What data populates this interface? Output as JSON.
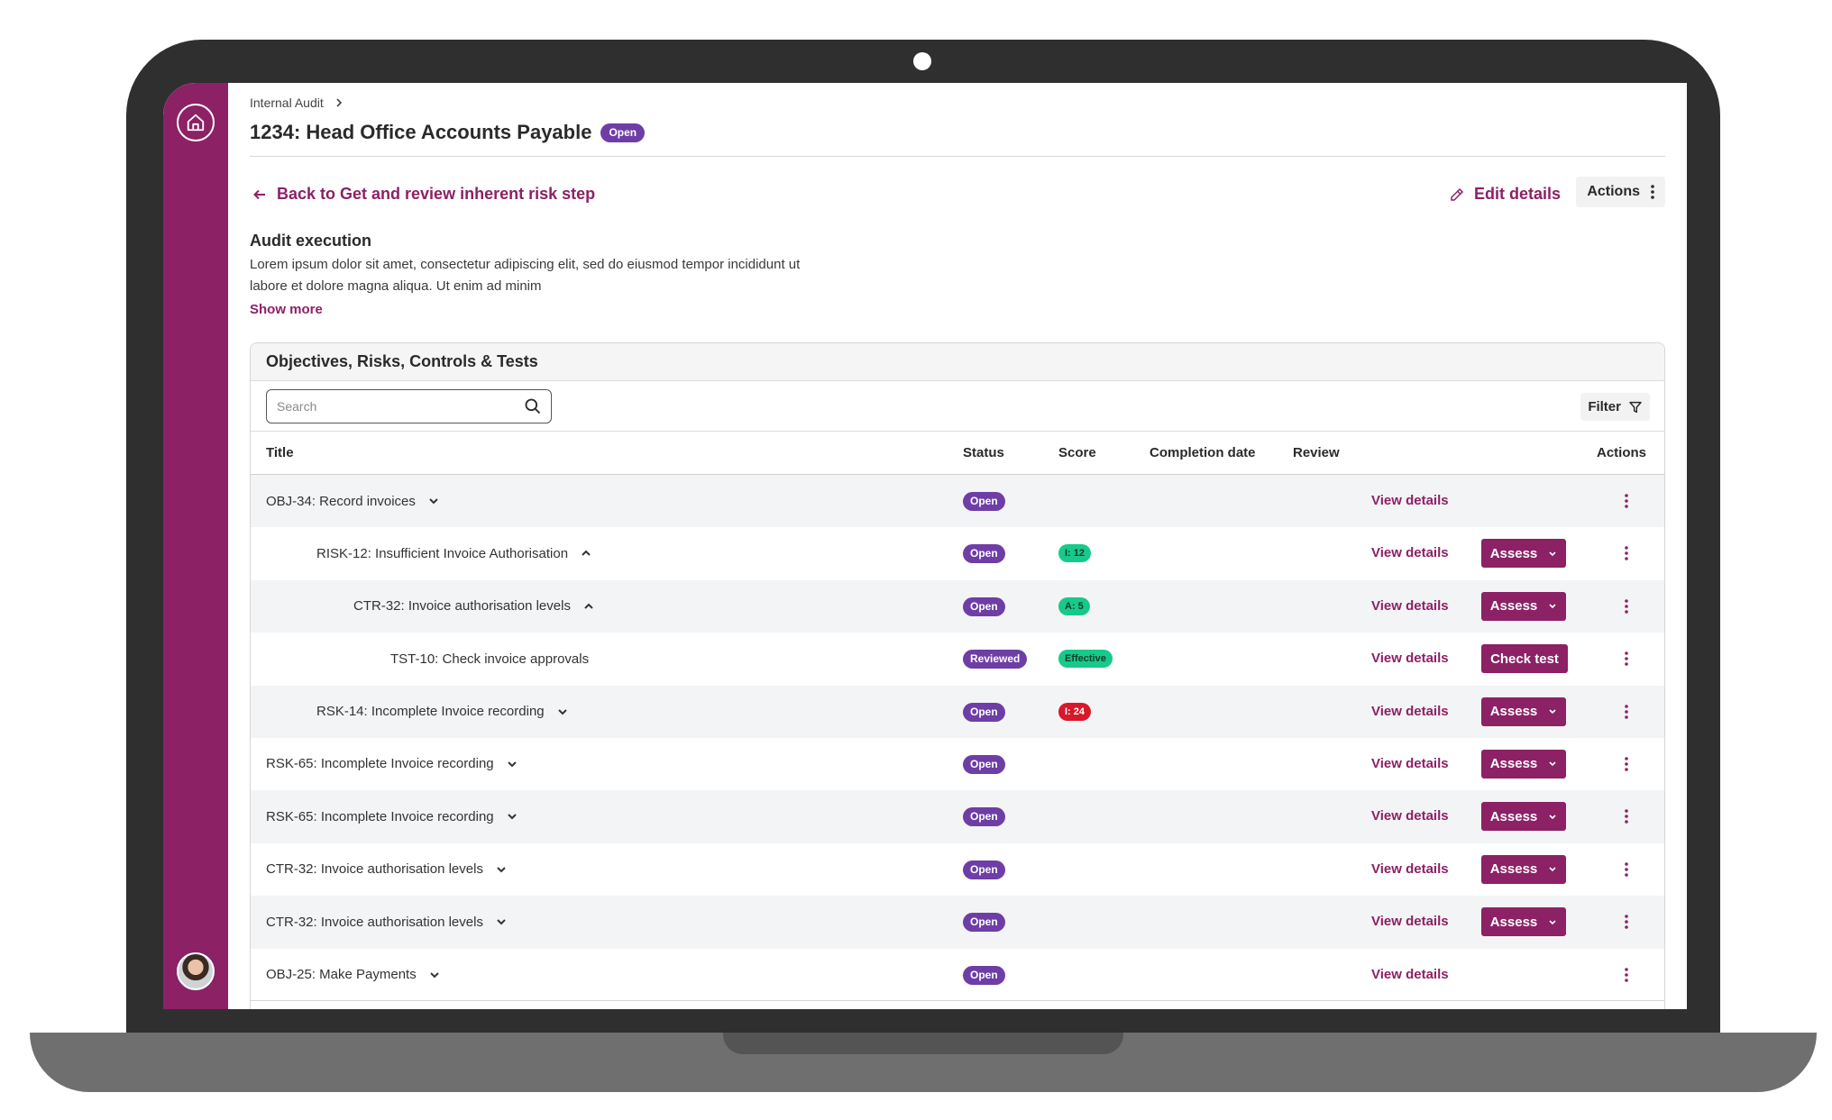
{
  "breadcrumb": {
    "parent": "Internal Audit"
  },
  "header": {
    "title": "1234: Head Office Accounts Payable",
    "status": "Open"
  },
  "nav": {
    "back_label": "Back to Get and review inherent risk step",
    "edit_label": "Edit details",
    "actions_label": "Actions"
  },
  "section": {
    "title": "Audit execution",
    "description": "Lorem ipsum dolor sit amet, consectetur adipiscing elit, sed do eiusmod tempor incididunt ut labore et dolore magna aliqua. Ut enim ad minim",
    "show_more": "Show more"
  },
  "panel": {
    "title": "Objectives, Risks, Controls & Tests",
    "search_placeholder": "Search",
    "filter_label": "Filter",
    "columns": {
      "title": "Title",
      "status": "Status",
      "score": "Score",
      "completion": "Completion date",
      "review": "Review",
      "actions": "Actions"
    }
  },
  "rows": [
    {
      "title": "OBJ-34: Record invoices",
      "status": "Open",
      "score": "",
      "view": "View details",
      "action": ""
    },
    {
      "title": "RISK-12: Insufficient Invoice Authorisation",
      "status": "Open",
      "score": "I: 12",
      "view": "View details",
      "action": "Assess"
    },
    {
      "title": "CTR-32: Invoice authorisation levels",
      "status": "Open",
      "score": "A: 5",
      "view": "View details",
      "action": "Assess"
    },
    {
      "title": "TST-10: Check invoice approvals",
      "status": "Reviewed",
      "score": "Effective",
      "view": "View details",
      "action": "Check test"
    },
    {
      "title": "RSK-14: Incomplete Invoice recording",
      "status": "Open",
      "score": "I: 24",
      "view": "View details",
      "action": "Assess"
    },
    {
      "title": "RSK-65: Incomplete Invoice recording",
      "status": "Open",
      "score": "",
      "view": "View details",
      "action": "Assess"
    },
    {
      "title": "RSK-65: Incomplete Invoice recording",
      "status": "Open",
      "score": "",
      "view": "View details",
      "action": "Assess"
    },
    {
      "title": "CTR-32: Invoice authorisation levels",
      "status": "Open",
      "score": "",
      "view": "View details",
      "action": "Assess"
    },
    {
      "title": "CTR-32: Invoice authorisation levels",
      "status": "Open",
      "score": "",
      "view": "View details",
      "action": "Assess"
    },
    {
      "title": "OBJ-25: Make Payments",
      "status": "Open",
      "score": "",
      "view": "View details",
      "action": ""
    }
  ],
  "colors": {
    "brand": "#8c2166",
    "status_pill": "#6e3ea6",
    "score_good": "#17c98a",
    "score_bad": "#d7192b"
  }
}
